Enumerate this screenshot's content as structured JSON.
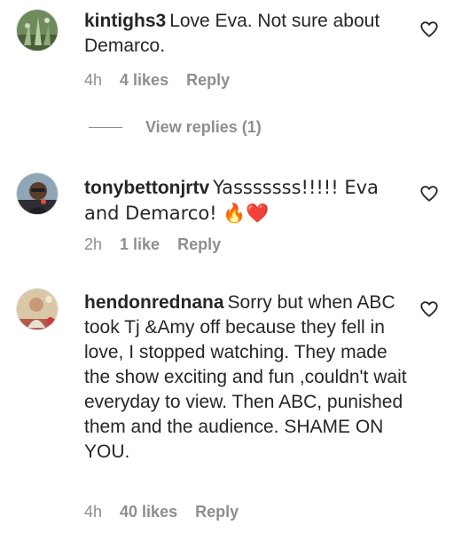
{
  "comments": [
    {
      "username": "kintighs3",
      "text": "Love Eva. Not sure about Demarco.",
      "time": "4h",
      "likes": "4 likes",
      "reply": "Reply",
      "avatar_icon": "plant-photo",
      "heart_icon": "heart-outline-icon"
    },
    {
      "username": "tonybettonjrtv",
      "text": "Yasssssss!!!!! Eva and Demarco! 🔥❤️",
      "time": "2h",
      "likes": "1 like",
      "reply": "Reply",
      "avatar_icon": "person-with-microphone-photo",
      "heart_icon": "heart-outline-icon"
    },
    {
      "username": "hendonrednana",
      "text": "Sorry but when ABC took Tj &Amy off because they fell in love, I stopped watching. They made the show exciting and fun ,couldn't wait everyday to view. Then ABC, punished them and the audience. SHAME ON YOU.",
      "time": "4h",
      "likes": "40 likes",
      "reply": "Reply",
      "avatar_icon": "person-photo",
      "heart_icon": "heart-outline-icon"
    }
  ],
  "view_replies": "View replies (1)",
  "colors": {
    "text": "#262626",
    "muted": "#8e8e8e"
  }
}
